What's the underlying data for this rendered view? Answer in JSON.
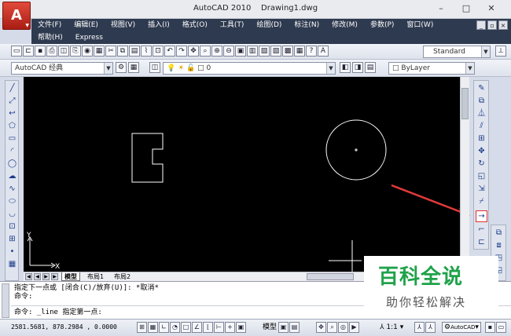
{
  "window": {
    "app_name": "AutoCAD 2010",
    "document": "Drawing1.dwg",
    "app_button_label": "A",
    "minimize": "–",
    "maximize": "□",
    "close": "✕"
  },
  "menu": {
    "row1": [
      "文件(F)",
      "编辑(E)",
      "视图(V)",
      "插入(I)",
      "格式(O)",
      "工具(T)",
      "绘图(D)",
      "标注(N)",
      "修改(M)",
      "参数(P)",
      "窗口(W)"
    ],
    "row2": [
      "帮助(H)",
      "Express"
    ],
    "mdi_buttons": [
      "_",
      "▫",
      "×"
    ]
  },
  "toolbar_standard": {
    "text_style_value": "Standard"
  },
  "toolbar_layers": {
    "workspace_value": "AutoCAD 经典",
    "layer_value": "0",
    "linetype_value": "ByLayer"
  },
  "drawing": {
    "ucs_y_label": "Y",
    "ucs_x_label": "X",
    "annotation_arrow_color": "#e03a3a"
  },
  "tabs": [
    "模型",
    "布局1",
    "布局2"
  ],
  "command": {
    "lines": [
      "指定下一点或 [闭合(C)/放弃(U)]: *取消*",
      "命令:",
      "命令:  _line 指定第一点:"
    ]
  },
  "status": {
    "coordinates": "2581.5681, 878.2984 , 0.0000",
    "model_label": "模型",
    "annotation_scale": "1:1",
    "workspace_label": "AutoCAD"
  },
  "watermark": {
    "title": "百科全说",
    "subtitle": "助你轻松解决"
  },
  "colors": {
    "drawing_background": "#000000",
    "geometry": "#ffffff",
    "menubar": "#2e3a4f",
    "watermark_green": "#1fa24a"
  }
}
